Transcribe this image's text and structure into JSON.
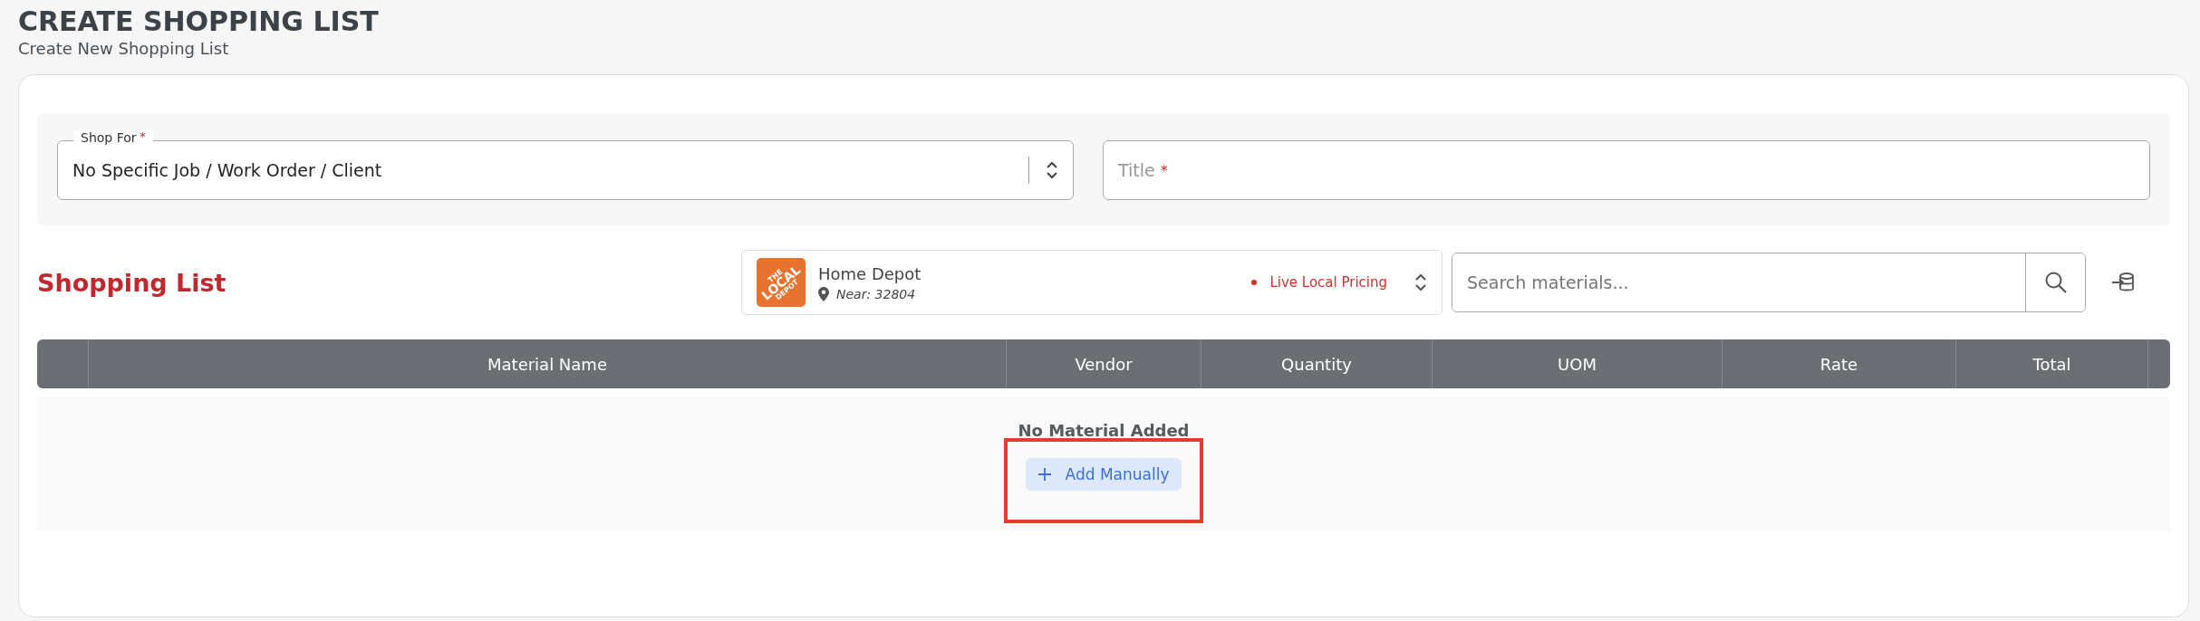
{
  "header": {
    "title": "CREATE SHOPPING LIST",
    "subtitle": "Create New Shopping List"
  },
  "form": {
    "shop_for": {
      "label": "Shop For",
      "required": true,
      "required_mark": "*",
      "value": "No Specific Job / Work Order / Client"
    },
    "title_field": {
      "placeholder": "Title",
      "required": true,
      "required_mark": "*"
    }
  },
  "shopping_list": {
    "heading": "Shopping List",
    "vendor": {
      "logo_lines": [
        "THE",
        "LOCAL",
        "DEPOT"
      ],
      "name": "Home Depot",
      "location": "Near: 32804",
      "pricing": "Live Local Pricing"
    },
    "search": {
      "placeholder": "Search materials..."
    }
  },
  "table": {
    "columns": [
      "",
      "Material Name",
      "Vendor",
      "Quantity",
      "UOM",
      "Rate",
      "Total",
      ""
    ],
    "empty_message": "No Material Added",
    "add_button": "Add Manually"
  },
  "annotation": {
    "highlight_add_button": true
  }
}
